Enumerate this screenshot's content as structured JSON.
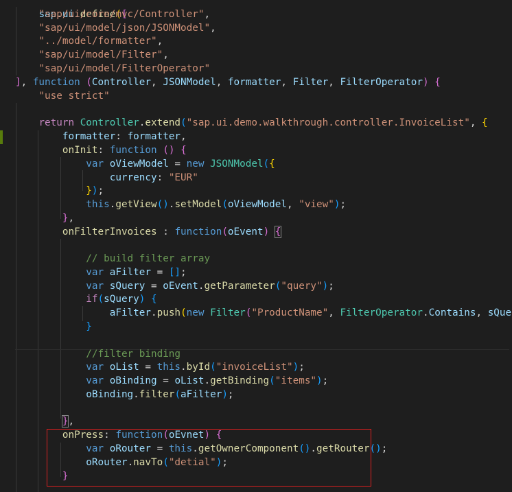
{
  "editor": {
    "lines": [
      "sap.ui.define([",
      "    \"sap/ui/core/mvc/Controller\",",
      "    \"sap/ui/model/json/JSONModel\",",
      "    \"../model/formatter\",",
      "    \"sap/ui/model/Filter\",",
      "    \"sap/ui/model/FilterOperator\"",
      "], function (Controller, JSONModel, formatter, Filter, FilterOperator) {",
      "    \"use strict\"",
      "",
      "    return Controller.extend(\"sap.ui.demo.walkthrough.controller.InvoiceList\", {",
      "        formatter: formatter,",
      "        onInit: function () {",
      "            var oViewModel = new JSONModel({",
      "                currency: \"EUR\"",
      "            });",
      "            this.getView().setModel(oViewModel, \"view\");",
      "        },",
      "        onFilterInvoices : function(oEvent) {",
      "",
      "            // build filter array",
      "            var aFilter = [];",
      "            var sQuery = oEvent.getParameter(\"query\");",
      "            if(sQuery) {",
      "                aFilter.push(new Filter(\"ProductName\", FilterOperator.Contains, sQuery));",
      "            }",
      "",
      "            //filter binding",
      "            var oList = this.byId(\"invoiceList\");",
      "            var oBinding = oList.getBinding(\"items\");",
      "            oBinding.filter(aFilter);",
      "",
      "        },",
      "        onPress: function(oEvnet) {",
      "            var oRouter = this.getOwnerComponent().getRouter();",
      "            oRouter.navTo(\"detial\");",
      "        }"
    ]
  },
  "colors": {
    "background": "#1e1e1e",
    "keyword": "#569cd6",
    "control_keyword": "#c586c0",
    "string": "#ce9178",
    "function": "#dcdcaa",
    "variable": "#9cdcfe",
    "class": "#4ec9b0",
    "comment": "#6a9955",
    "highlight_box": "#e02020",
    "git_gutter_added": "#587c0c"
  }
}
